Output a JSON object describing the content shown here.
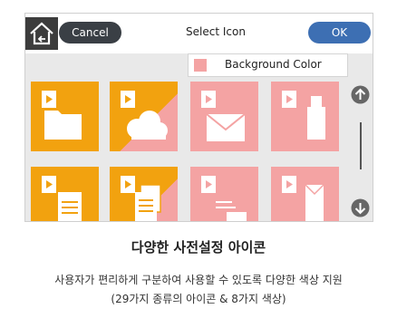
{
  "colors": {
    "orange": "#f2a20f",
    "pink": "#f4a3a3",
    "cancel": "#3a3f45",
    "ok": "#3d6fb3",
    "home": "#3c3c3c",
    "panel": "#e9e9e9"
  },
  "topbar": {
    "cancel_label": "Cancel",
    "title": "Select Icon",
    "ok_label": "OK",
    "home_icon": "home-back-icon"
  },
  "background_color": {
    "label": "Background Color"
  },
  "tiles": [
    {
      "icon": "folder-icon",
      "color": "orange"
    },
    {
      "icon": "cloud-icon",
      "color": "orange-pink"
    },
    {
      "icon": "envelope-icon",
      "color": "pink"
    },
    {
      "icon": "usb-drive-icon",
      "color": "pink"
    },
    {
      "icon": "document-icon",
      "color": "orange"
    },
    {
      "icon": "documents-icon",
      "color": "orange-pink"
    },
    {
      "icon": "fax-document-icon",
      "color": "pink"
    },
    {
      "icon": "envelope-document-icon",
      "color": "pink"
    }
  ],
  "scrollbar": {
    "up_icon": "arrow-up-icon",
    "down_icon": "arrow-down-icon"
  },
  "caption": {
    "title": "다양한 사전설정 아이콘",
    "line1": "사용자가 편리하게 구분하여 사용할 수 있도록 다양한 색상 지원",
    "line2": "(29가지 종류의 아이콘 & 8가지 색상)"
  }
}
